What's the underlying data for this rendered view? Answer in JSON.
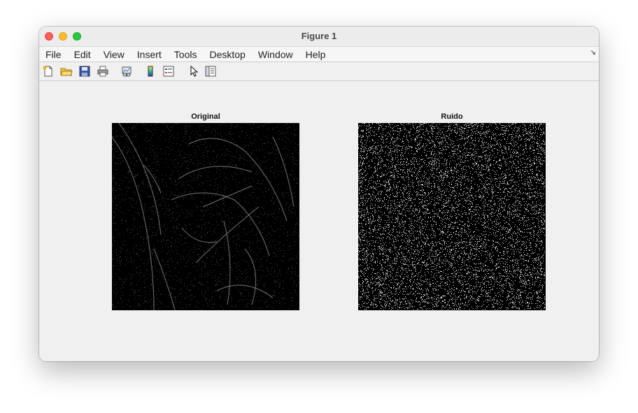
{
  "window": {
    "title": "Figure 1"
  },
  "menu": {
    "items": [
      "File",
      "Edit",
      "View",
      "Insert",
      "Tools",
      "Desktop",
      "Window",
      "Help"
    ]
  },
  "toolbar": {
    "icons": [
      "new-figure-icon",
      "open-file-icon",
      "save-icon",
      "print-icon",
      "link-plot-icon",
      "insert-colorbar-icon",
      "insert-legend-icon",
      "edit-plot-icon",
      "property-inspector-icon"
    ]
  },
  "axes": {
    "left": {
      "title": "Original"
    },
    "right": {
      "title": "Ruido"
    }
  }
}
